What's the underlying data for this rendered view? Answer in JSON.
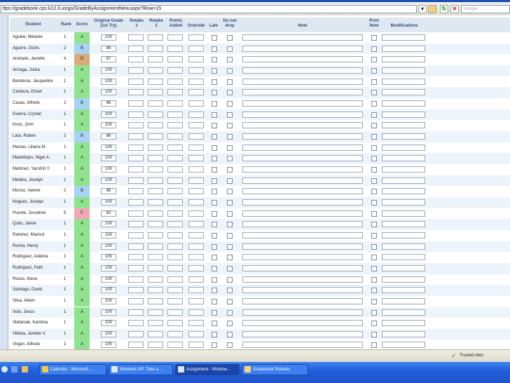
{
  "browser": {
    "url": "ttps://gradebook.cps.k12.il.us/gs/GradeByAssignmentNew.aspx?Row=15",
    "search_placeholder": "Google"
  },
  "table": {
    "headers": {
      "student": "Student",
      "rank": "Rank",
      "score": "Score",
      "original_grade_1": "Original Grade",
      "original_grade_2": "(1st Try)",
      "retake1_1": "Retake",
      "retake1_2": "1",
      "retake2_1": "Retake",
      "retake2_2": "2",
      "points_1": "Points",
      "points_2": "Added",
      "override": "Override",
      "late": "Late",
      "donotdrop_1": "Do not",
      "donotdrop_2": "drop",
      "note": "Note",
      "print_1": "Print",
      "print_2": "Note",
      "modifications": "Modifications"
    },
    "rows": [
      {
        "name": "Aguilar, Melanie",
        "rank": "1",
        "score": "A",
        "grade": "100"
      },
      {
        "name": "Aguirre, Osiris",
        "rank": "2",
        "score": "B",
        "grade": "86"
      },
      {
        "name": "Andrade, Janette",
        "rank": "4",
        "score": "D",
        "grade": "67"
      },
      {
        "name": "Arizaga, Juliza",
        "rank": "1",
        "score": "A",
        "grade": "100"
      },
      {
        "name": "Banderas, Jacqueline",
        "rank": "1",
        "score": "A",
        "grade": "100"
      },
      {
        "name": "Cardoza, Grisel",
        "rank": "1",
        "score": "A",
        "grade": "100"
      },
      {
        "name": "Casas, Alfredo",
        "rank": "2",
        "score": "B",
        "grade": "86"
      },
      {
        "name": "Guerra, Crystal",
        "rank": "1",
        "score": "A",
        "grade": "100"
      },
      {
        "name": "Knox, John",
        "rank": "1",
        "score": "A",
        "grade": "100"
      },
      {
        "name": "Lara, Ruben",
        "rank": "2",
        "score": "B",
        "grade": "86"
      },
      {
        "name": "Macias, Liliana M.",
        "rank": "1",
        "score": "A",
        "grade": "100"
      },
      {
        "name": "Madridejos, Nigel A.",
        "rank": "1",
        "score": "A",
        "grade": "100"
      },
      {
        "name": "Martinez, Yacshiri Y.",
        "rank": "1",
        "score": "A",
        "grade": "100"
      },
      {
        "name": "Medina, Jocelyn",
        "rank": "1",
        "score": "A",
        "grade": "100"
      },
      {
        "name": "Munoz, Valerie",
        "rank": "2",
        "score": "B",
        "grade": "86"
      },
      {
        "name": "Noguez, Jocelyn",
        "rank": "1",
        "score": "A",
        "grade": "100"
      },
      {
        "name": "Puente, Josseline",
        "rank": "5",
        "score": "F",
        "grade": "50"
      },
      {
        "name": "Quito, Jaime",
        "rank": "1",
        "score": "A",
        "grade": "100"
      },
      {
        "name": "Ramirez, Marisol",
        "rank": "1",
        "score": "A",
        "grade": "100"
      },
      {
        "name": "Rocha, Henry",
        "rank": "1",
        "score": "A",
        "grade": "100"
      },
      {
        "name": "Rodriguez, Adelina",
        "rank": "1",
        "score": "A",
        "grade": "100"
      },
      {
        "name": "Rodriguez, Patti",
        "rank": "1",
        "score": "A",
        "grade": "100"
      },
      {
        "name": "Rosas, Alexa",
        "rank": "1",
        "score": "A",
        "grade": "100"
      },
      {
        "name": "Santiago, David",
        "rank": "1",
        "score": "A",
        "grade": "100"
      },
      {
        "name": "Silva, Albert",
        "rank": "1",
        "score": "A",
        "grade": "100"
      },
      {
        "name": "Soto, Jesus",
        "rank": "1",
        "score": "A",
        "grade": "100"
      },
      {
        "name": "Stefaniak, Karolina",
        "rank": "1",
        "score": "A",
        "grade": "100"
      },
      {
        "name": "Villeda, Janette V.",
        "rank": "1",
        "score": "A",
        "grade": "100"
      },
      {
        "name": "Virgen, Alfredo",
        "rank": "1",
        "score": "A",
        "grade": "100"
      }
    ]
  },
  "score_colors": {
    "A": "#8fe38f",
    "B": "#a9d3f2",
    "D": "#d9aa7a",
    "F": "#f4a6b8"
  },
  "status": {
    "trusted": "Trusted sites"
  },
  "taskbar": {
    "items": [
      {
        "label": "Calendar - Microsoft ...",
        "icon": "calendar-icon"
      },
      {
        "label": "Windows XP: Take a ...",
        "icon": "ie-icon"
      },
      {
        "label": "Assignment - Window...",
        "icon": "ie-icon"
      },
      {
        "label": "Gradebook Pictures",
        "icon": "folder-icon"
      }
    ]
  }
}
